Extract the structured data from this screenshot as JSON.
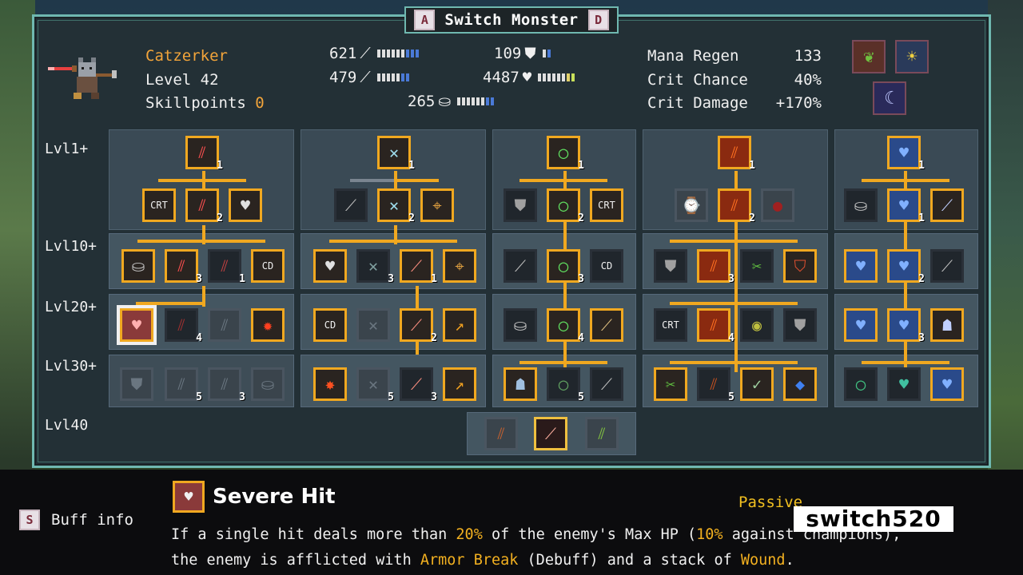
{
  "title": {
    "key_left": "A",
    "label": "Switch Monster",
    "key_right": "D"
  },
  "monster": {
    "name": "Catzerker",
    "level_label": "Level 42",
    "skillpoints_label": "Skillpoints",
    "skillpoints_value": "0"
  },
  "stats": {
    "attack": "621",
    "magic": "479",
    "defense": "109",
    "health": "4487",
    "mana": "265"
  },
  "right_stats": [
    {
      "label": "Mana Regen",
      "value": "133"
    },
    {
      "label": "Crit Chance",
      "value": "40%"
    },
    {
      "label": "Crit Damage",
      "value": "+170%"
    }
  ],
  "levels": [
    "Lvl1+",
    "Lvl10+",
    "Lvl20+",
    "Lvl30+",
    "Lvl40"
  ],
  "skill_levels": {
    "c1": [
      "1",
      "2",
      "3",
      "1",
      "4",
      "5",
      "3"
    ],
    "c2": [
      "1",
      "2",
      "3",
      "1",
      "2",
      "5",
      "3"
    ],
    "c3": [
      "1",
      "2",
      "3",
      "4",
      "5"
    ],
    "c4": [
      "1",
      "2",
      "3",
      "4",
      "5"
    ],
    "c5": [
      "1",
      "1",
      "2",
      "3"
    ]
  },
  "bottom": {
    "key": "S",
    "buff_info": "Buff info",
    "skill_name": "Severe Hit",
    "passive": "Passive",
    "desc_1a": "If a single hit deals more than ",
    "desc_pct1": "20%",
    "desc_1b": " of the enemy's Max HP (",
    "desc_pct2": "10%",
    "desc_1c": " against champions),",
    "desc_2a": "the enemy is afflicted with ",
    "desc_ab": "Armor Break",
    "desc_2b": " (Debuff) and a stack of ",
    "desc_wound": "Wound",
    "desc_2c": "."
  },
  "watermark": "switch520"
}
